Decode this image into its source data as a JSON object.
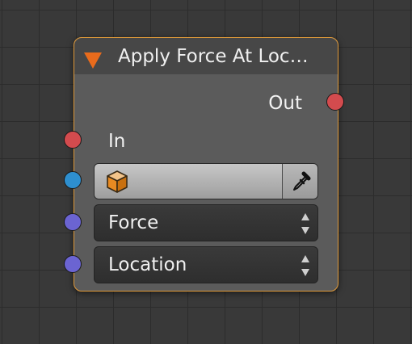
{
  "node": {
    "title": "Apply Force At Loc…",
    "output_label": "Out",
    "input_label": "In",
    "object_field": {
      "icon": "object-cube-icon",
      "value": ""
    },
    "eyedropper_icon": "eyedropper-icon",
    "force_dropdown": {
      "label": "Force"
    },
    "location_dropdown": {
      "label": "Location"
    }
  },
  "colors": {
    "node_border": "#e09a3a",
    "collapse_arrow": "#e96b1c",
    "socket_logic": "#d34b4e",
    "socket_object": "#2e8fcf",
    "socket_vector": "#6b64d2"
  }
}
